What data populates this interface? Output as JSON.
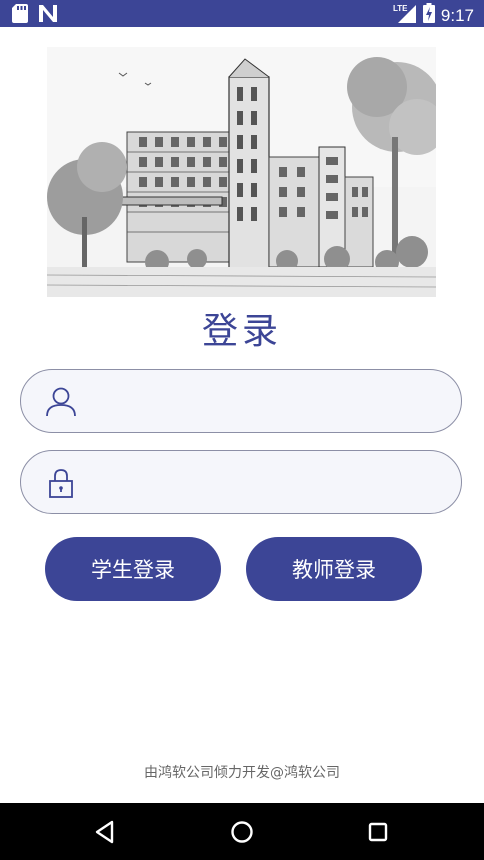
{
  "status_bar": {
    "network_label": "LTE",
    "time": "9:17",
    "left_icons": [
      "sd-card-icon",
      "n-notification-icon"
    ],
    "right_icons": [
      "signal-icon",
      "battery-charging-icon"
    ]
  },
  "hero": {
    "image": "campus-building-sketch"
  },
  "login": {
    "title": "登录",
    "username": {
      "value": "",
      "placeholder": "",
      "icon": "user-icon"
    },
    "password": {
      "value": "",
      "placeholder": "",
      "icon": "lock-icon"
    },
    "student_button": "学生登录",
    "teacher_button": "教师登录"
  },
  "footer": {
    "text": "由鸿软公司倾力开发@鸿软公司"
  },
  "nav_bar": {
    "buttons": [
      "back-icon",
      "home-icon",
      "recent-apps-icon"
    ]
  },
  "colors": {
    "accent": "#3c4596",
    "field_bg": "#f5f6fb",
    "field_border": "#8c8fa6",
    "footer_text": "#666666"
  }
}
